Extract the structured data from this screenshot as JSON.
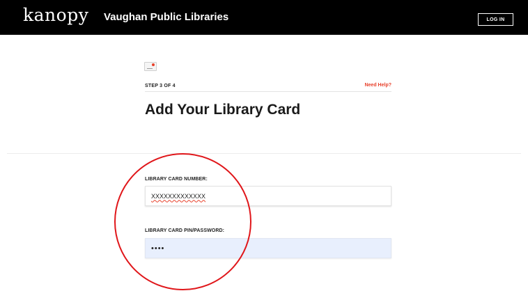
{
  "header": {
    "logo": "kanopy",
    "library_name": "Vaughan Public Libraries",
    "login_label": "LOG IN"
  },
  "step": {
    "label": "STEP 3 OF 4",
    "help_label": "Need Help?"
  },
  "page_title": "Add Your Library Card",
  "form": {
    "card_number_label": "LIBRARY CARD NUMBER:",
    "card_number_value": "XXXXXXXXXXXXX",
    "pin_label": "LIBRARY CARD PIN/PASSWORD:",
    "pin_value": "••••"
  },
  "colors": {
    "header_bg": "#000000",
    "accent": "#e8412b",
    "annotation": "#e0161a",
    "autofill_bg": "#e8effd"
  },
  "icons": {
    "card": "library-card-icon"
  }
}
